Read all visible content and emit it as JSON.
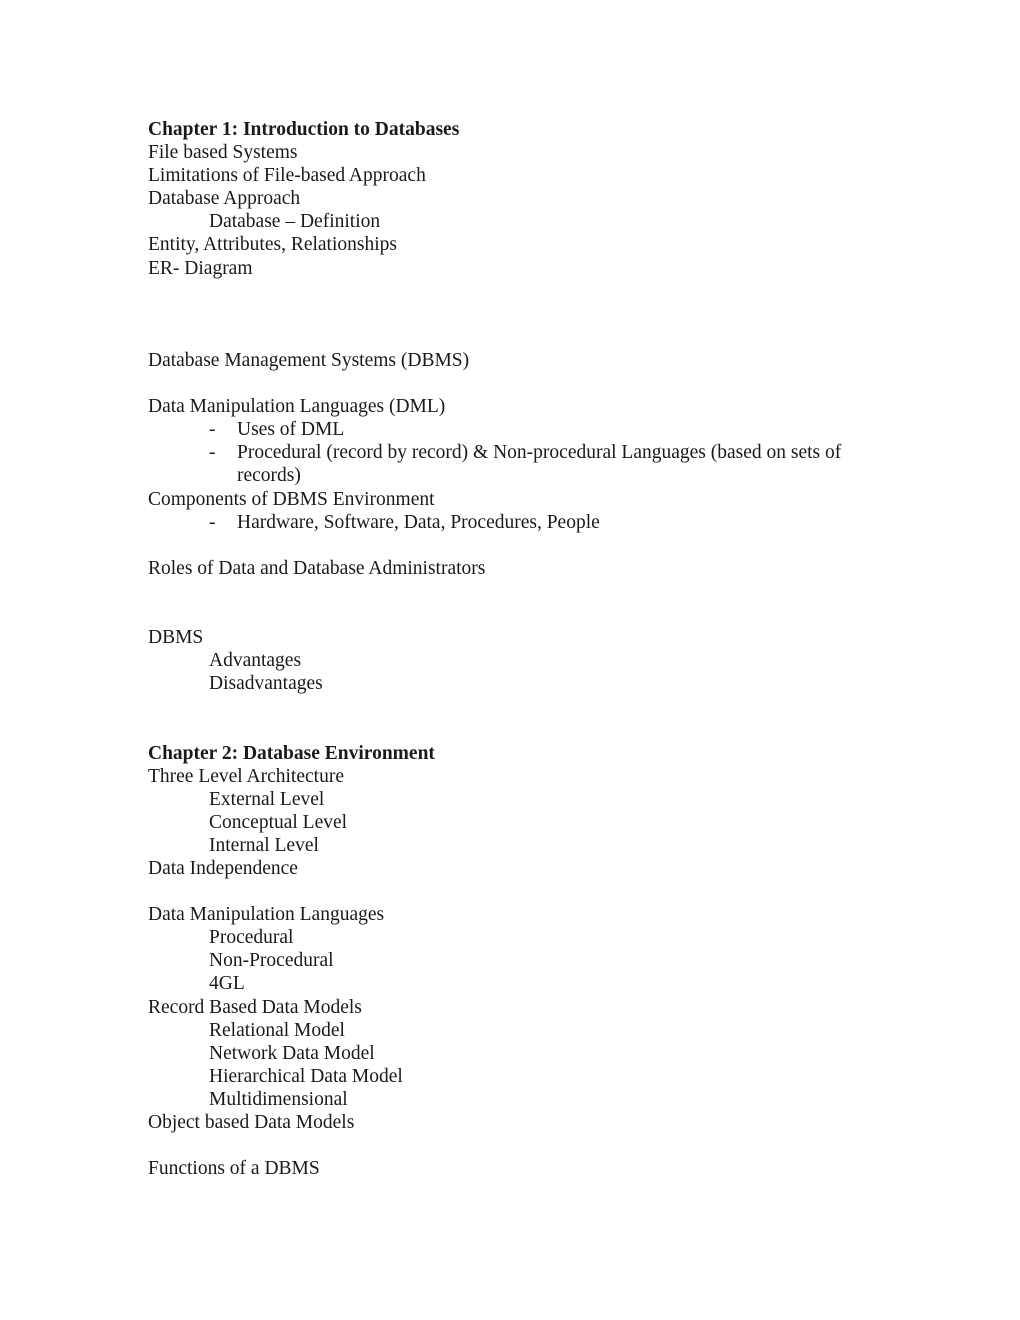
{
  "document": {
    "title": "Chapter 1: Introduction to Databases",
    "bullet_marker": "-",
    "blocks": [
      {
        "id": "chapter1",
        "lines": [
          {
            "text": "Chapter 1: Introduction to Databases",
            "style": "bold",
            "indent": 0
          },
          {
            "text": "File based Systems",
            "style": "normal",
            "indent": 0
          },
          {
            "text": "Limitations of File-based Approach",
            "style": "normal",
            "indent": 0
          },
          {
            "text": "Database Approach",
            "style": "normal",
            "indent": 0
          },
          {
            "text": "Database – Definition",
            "style": "normal",
            "indent": 1
          },
          {
            "text": "Entity, Attributes, Relationships",
            "style": "normal",
            "indent": 0
          },
          {
            "text": "ER- Diagram",
            "style": "normal",
            "indent": 0
          }
        ]
      },
      {
        "id": "dbms-heading",
        "lines": [
          {
            "text": "Database Management Systems (DBMS)",
            "style": "normal",
            "indent": 0
          }
        ]
      },
      {
        "id": "dml",
        "lines": [
          {
            "text": "Data Manipulation Languages (DML)",
            "style": "normal",
            "indent": 0
          },
          {
            "text": "Uses of DML",
            "style": "normal",
            "indent": 0,
            "bullet": true
          },
          {
            "text": "Procedural (record by record) & Non-procedural Languages (based on sets of records)",
            "style": "normal",
            "indent": 0,
            "bullet": true
          },
          {
            "text": "Components of DBMS Environment",
            "style": "normal",
            "indent": 0
          },
          {
            "text": "Hardware, Software, Data, Procedures, People",
            "style": "normal",
            "indent": 0,
            "bullet": true
          }
        ]
      },
      {
        "id": "roles",
        "lines": [
          {
            "text": "Roles of Data and Database Administrators",
            "style": "normal",
            "indent": 0
          }
        ]
      },
      {
        "id": "dbms-pros-cons",
        "lines": [
          {
            "text": "DBMS",
            "style": "normal",
            "indent": 0
          },
          {
            "text": "Advantages",
            "style": "normal",
            "indent": 1
          },
          {
            "text": "Disadvantages",
            "style": "normal",
            "indent": 1
          }
        ]
      },
      {
        "id": "chapter2",
        "lines": [
          {
            "text": "Chapter 2: Database Environment",
            "style": "bold",
            "indent": 0
          },
          {
            "text": "Three Level Architecture",
            "style": "normal",
            "indent": 0
          },
          {
            "text": "External Level",
            "style": "normal",
            "indent": 1
          },
          {
            "text": "Conceptual Level",
            "style": "normal",
            "indent": 1
          },
          {
            "text": "Internal Level",
            "style": "normal",
            "indent": 1
          },
          {
            "text": "Data Independence",
            "style": "normal",
            "indent": 0
          }
        ]
      },
      {
        "id": "data-models",
        "lines": [
          {
            "text": "Data Manipulation Languages",
            "style": "normal",
            "indent": 0
          },
          {
            "text": "Procedural",
            "style": "normal",
            "indent": 1
          },
          {
            "text": "Non-Procedural",
            "style": "normal",
            "indent": 1
          },
          {
            "text": "4GL",
            "style": "normal",
            "indent": 1
          },
          {
            "text": "Record Based Data Models",
            "style": "normal",
            "indent": 0
          },
          {
            "text": "Relational Model",
            "style": "normal",
            "indent": 1
          },
          {
            "text": "Network Data Model",
            "style": "normal",
            "indent": 1
          },
          {
            "text": "Hierarchical Data Model",
            "style": "normal",
            "indent": 1
          },
          {
            "text": "Multidimensional",
            "style": "normal",
            "indent": 1
          },
          {
            "text": "Object based Data Models",
            "style": "normal",
            "indent": 0
          }
        ]
      },
      {
        "id": "functions",
        "lines": [
          {
            "text": "Functions of a DBMS",
            "style": "normal",
            "indent": 0
          }
        ]
      }
    ],
    "gaps": {
      "after_chapter1": 3,
      "after_dbms_heading": 1,
      "after_dml": 1,
      "after_roles": 2,
      "after_pros_cons": 2,
      "after_chapter2": 1,
      "after_data_models": 1
    }
  }
}
